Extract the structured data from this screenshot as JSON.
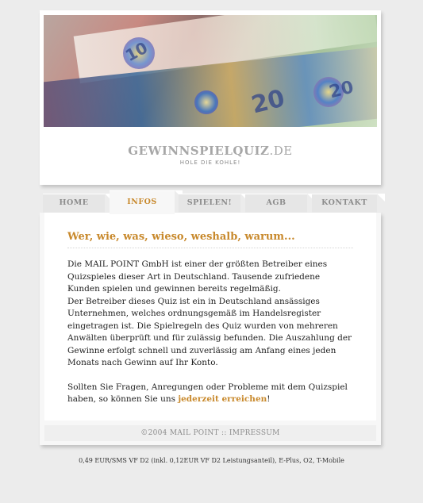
{
  "header": {
    "logo_main": "GEWINNSPIELQUIZ",
    "logo_tld": ".DE",
    "tagline": "HOLE DIE KOHLE!",
    "banner_numbers": [
      "10",
      "20",
      "20"
    ]
  },
  "nav": {
    "tabs": [
      {
        "label": "HOME"
      },
      {
        "label": "INFOS"
      },
      {
        "label": "SPIELEN!"
      },
      {
        "label": "AGB"
      },
      {
        "label": "KONTAKT"
      }
    ]
  },
  "main": {
    "heading": "Wer, wie, was, wieso, weshalb, warum...",
    "paragraph1": "Die MAIL POINT GmbH ist einer der größten Betreiber eines Quizspieles dieser Art in Deutschland. Tausende zufriedene Kunden spielen und gewinnen bereits regelmäßig.",
    "paragraph2": "Der Betreiber dieses Quiz ist ein in Deutschland ansässiges Unternehmen, welches ordnungsgemäß im Handelsregister eingetragen ist. Die Spielregeln des Quiz wurden von mehreren Anwälten überprüft und für zulässig befunden. Die Auszahlung der Gewinne erfolgt schnell und zuverlässig am Anfang eines jeden Monats nach Gewinn auf Ihr Konto.",
    "paragraph3_prefix": "Sollten Sie Fragen, Anregungen oder Probleme mit dem Quizspiel haben, so können Sie uns ",
    "paragraph3_link": "jederzeit erreichen",
    "paragraph3_suffix": "!"
  },
  "footer": {
    "copyright": "©2004 MAIL POINT",
    "separator": "::",
    "impressum": "IMPRESSUM"
  },
  "bottom_note": "0,49 EUR/SMS VF D2 (inkl. 0,12EUR VF D2 Leistungsanteil), E-Plus, O2, T-Mobile",
  "colors": {
    "accent": "#c8892c",
    "background": "#ececec",
    "muted_text": "#8c8c8c"
  }
}
